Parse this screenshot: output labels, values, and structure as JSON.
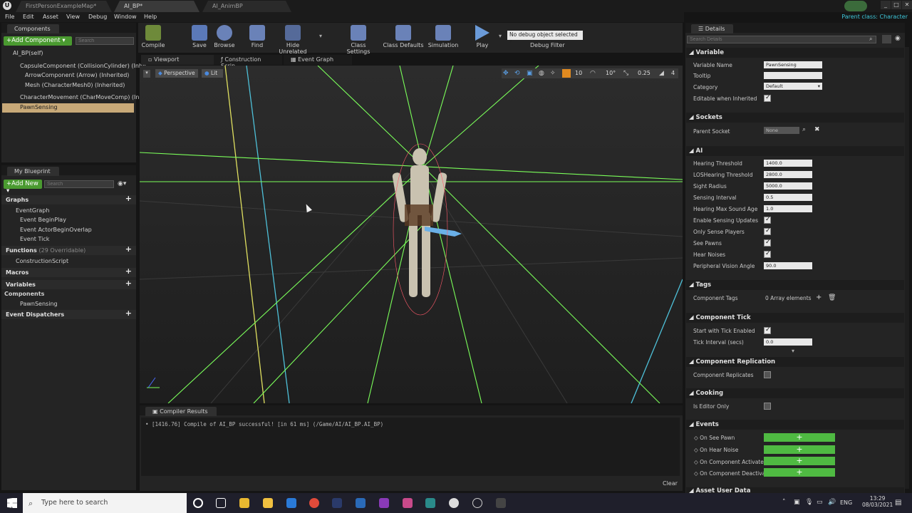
{
  "tabs": {
    "t1": "FirstPersonExampleMap*",
    "t2": "AI_BP*",
    "t3": "AI_AnimBP"
  },
  "parent_class": "Parent class:  Character",
  "menu": [
    "File",
    "Edit",
    "Asset",
    "View",
    "Debug",
    "Window",
    "Help"
  ],
  "components": {
    "title": "Components",
    "add_label": "+Add Component ▾",
    "search_placeholder": "Search",
    "self": "AI_BP(self)",
    "items": [
      "CapsuleComponent (CollisionCylinder) (Inhe",
      "ArrowComponent (Arrow) (Inherited)",
      "Mesh (CharacterMesh0) (Inherited)",
      "CharacterMovement (CharMoveComp) (Inher",
      "PawnSensing"
    ]
  },
  "blueprint": {
    "title": "My Blueprint",
    "add_label": "+Add New ▾",
    "search_placeholder": "Search",
    "graphs": "Graphs",
    "event_graph": "EventGraph",
    "events": [
      "Event BeginPlay",
      "Event ActorBeginOverlap",
      "Event Tick"
    ],
    "functions": "Functions",
    "functions_note": "(29 Overridable)",
    "construction": "ConstructionScript",
    "macros": "Macros",
    "variables": "Variables",
    "components": "Components",
    "pawn_sensing": "PawnSensing",
    "dispatchers": "Event Dispatchers"
  },
  "toolbar": {
    "compile": "Compile",
    "save": "Save",
    "browse": "Browse",
    "find": "Find",
    "hide_unrelated": "Hide Unrelated",
    "class_settings": "Class Settings",
    "class_defaults": "Class Defaults",
    "simulation": "Simulation",
    "play": "Play",
    "debug_object": "No debug object selected ▾",
    "debug_filter": "Debug Filter"
  },
  "view_tabs": [
    "Viewport",
    "Construction Scrip",
    "Event Graph"
  ],
  "viewport": {
    "perspective": "Perspective",
    "lit": "Lit",
    "snap_grid": "10",
    "snap_angle": "10°",
    "snap_scale": "0.25",
    "camera_speed": "4"
  },
  "compiler": {
    "title": "Compiler Results",
    "message": "• [1416.76] Compile of AI_BP successful! [in 61 ms] (/Game/AI/AI_BP.AI_BP)",
    "clear": "Clear"
  },
  "details": {
    "title": "Details",
    "search_placeholder": "Search Details",
    "variable": {
      "section": "Variable",
      "name_label": "Variable Name",
      "name_value": "PawnSensing",
      "tooltip_label": "Tooltip",
      "category_label": "Category",
      "category_value": "Default",
      "editable_label": "Editable when Inherited"
    },
    "sockets": {
      "section": "Sockets",
      "parent_label": "Parent Socket",
      "parent_value": "None"
    },
    "ai": {
      "section": "AI",
      "hearing_label": "Hearing Threshold",
      "hearing_value": "1400.0",
      "los_label": "LOSHearing Threshold",
      "los_value": "2800.0",
      "sight_label": "Sight Radius",
      "sight_value": "5000.0",
      "interval_label": "Sensing Interval",
      "interval_value": "0.5",
      "maxage_label": "Hearing Max Sound Age",
      "maxage_value": "1.0",
      "enable_label": "Enable Sensing Updates",
      "only_label": "Only Sense Players",
      "see_label": "See Pawns",
      "hear_label": "Hear Noises",
      "angle_label": "Peripheral Vision Angle",
      "angle_value": "90.0"
    },
    "tags": {
      "section": "Tags",
      "label": "Component Tags",
      "value": "0 Array elements"
    },
    "tick": {
      "section": "Component Tick",
      "start_label": "Start with Tick Enabled",
      "interval_label": "Tick Interval (secs)",
      "interval_value": "0.0"
    },
    "replication": {
      "section": "Component Replication",
      "label": "Component Replicates"
    },
    "cooking": {
      "section": "Cooking",
      "label": "Is Editor Only"
    },
    "events": {
      "section": "Events",
      "items": [
        "On See Pawn",
        "On Hear Noise",
        "On Component Activate",
        "On Component Deactiva"
      ]
    },
    "asset_user": "Asset User Data"
  },
  "taskbar": {
    "search": "Type here to search",
    "lang": "ENG",
    "time": "13:29",
    "date": "08/03/2021"
  },
  "colors": {
    "accent_green": "#4a9a30",
    "event_green": "#4fba42",
    "selected_row": "#c8a978"
  }
}
